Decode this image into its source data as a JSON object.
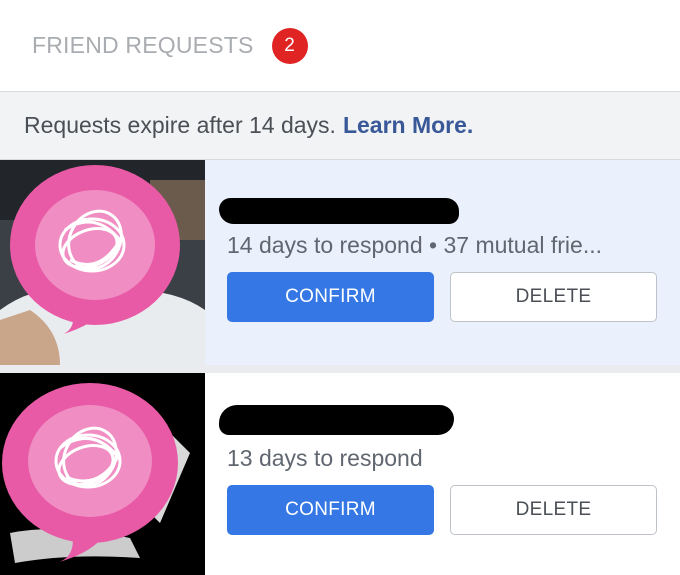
{
  "header": {
    "title": "FRIEND REQUESTS",
    "count": "2"
  },
  "notice": {
    "text": "Requests expire after 14 days.",
    "link_label": "Learn More."
  },
  "requests": [
    {
      "meta": "14 days to respond • 37 mutual frie...",
      "confirm_label": "CONFIRM",
      "delete_label": "DELETE",
      "highlighted": true
    },
    {
      "meta": "13 days to respond",
      "confirm_label": "CONFIRM",
      "delete_label": "DELETE",
      "highlighted": false
    }
  ],
  "colors": {
    "accent": "#3578e5",
    "badge": "#e02424",
    "link": "#385898",
    "highlight_bg": "#eaf0fc"
  },
  "icons": [
    "redaction-scribble-icon"
  ]
}
